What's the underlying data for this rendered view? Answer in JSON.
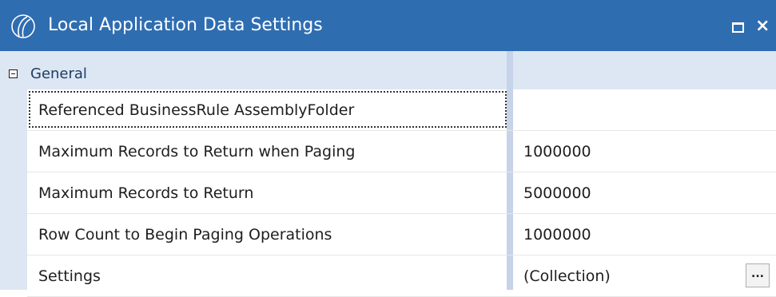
{
  "window": {
    "title": "Local Application Data Settings",
    "app_icon": "application-logo-icon",
    "maximize_icon": "maximize-icon",
    "close_icon": "close-icon",
    "close_glyph": "×"
  },
  "colors": {
    "titlebar": "#2f6db1",
    "category_background": "#dde7f3",
    "splitter": "#c6d3e8",
    "text": "#1e1e1e"
  },
  "grid": {
    "category": {
      "label": "General",
      "expanded": true,
      "collapse_icon": "collapse-minus-icon"
    },
    "rows": [
      {
        "name": "Referenced BusinessRule AssemblyFolder",
        "value": "",
        "selected": true
      },
      {
        "name": "Maximum Records to Return when Paging",
        "value": "1000000"
      },
      {
        "name": "Maximum Records to Return",
        "value": "5000000"
      },
      {
        "name": "Row Count to Begin Paging Operations",
        "value": "1000000"
      },
      {
        "name": "Settings",
        "value": "(Collection)",
        "button_label": "...",
        "button_icon": "ellipsis-icon"
      }
    ]
  }
}
